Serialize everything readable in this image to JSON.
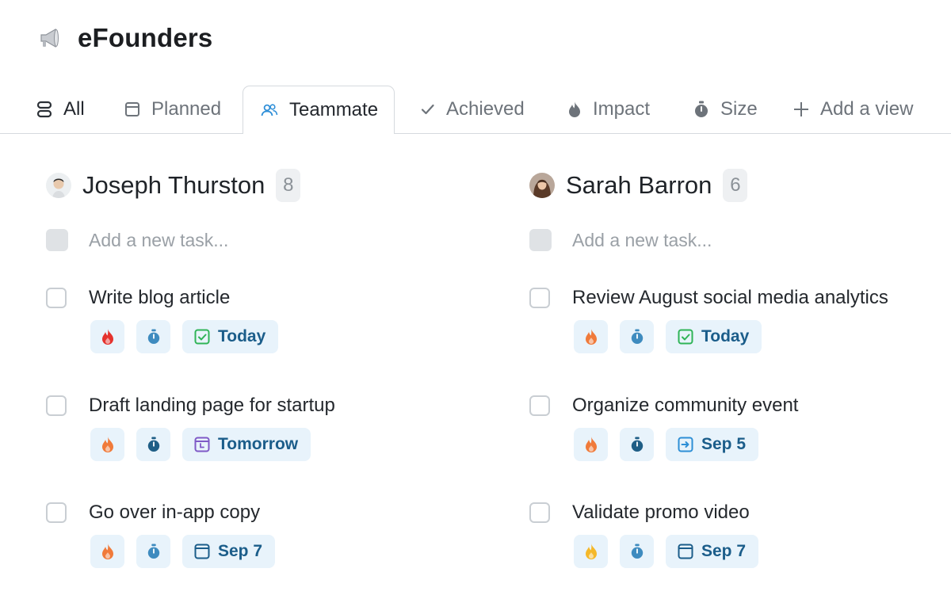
{
  "header": {
    "title": "eFounders",
    "logo_icon": "megaphone-icon"
  },
  "tabs": [
    {
      "label": "All",
      "icon": "stack-icon"
    },
    {
      "label": "Planned",
      "icon": "calendar-icon"
    },
    {
      "label": "Teammate",
      "icon": "people-icon",
      "active": true
    },
    {
      "label": "Achieved",
      "icon": "check-icon"
    },
    {
      "label": "Impact",
      "icon": "flame-icon"
    },
    {
      "label": "Size",
      "icon": "stopwatch-icon"
    },
    {
      "label": "Add a view",
      "icon": "plus-icon"
    }
  ],
  "columns": [
    {
      "name": "Joseph Thurston",
      "count": "8",
      "add_placeholder": "Add a new task...",
      "tasks": [
        {
          "title": "Write blog article",
          "date": "Today",
          "impact_color": "#e5322d",
          "date_icon": "calendar-check-icon"
        },
        {
          "title": "Draft landing page for startup",
          "date": "Tomorrow",
          "impact_color": "#f07a3a",
          "date_icon": "calendar-clock-icon"
        },
        {
          "title": "Go over in-app copy",
          "date": "Sep 7",
          "impact_color": "#f07a3a",
          "date_icon": "calendar-icon"
        }
      ]
    },
    {
      "name": "Sarah Barron",
      "count": "6",
      "add_placeholder": "Add a new task...",
      "tasks": [
        {
          "title": "Review August social media analytics",
          "date": "Today",
          "impact_color": "#f07a3a",
          "date_icon": "calendar-check-icon"
        },
        {
          "title": "Organize community event",
          "date": "Sep 5",
          "impact_color": "#f07a3a",
          "date_icon": "calendar-arrow-icon"
        },
        {
          "title": "Validate promo video",
          "date": "Sep 7",
          "impact_color": "#f5b829",
          "date_icon": "calendar-icon"
        }
      ]
    }
  ],
  "colors": {
    "chip_bg": "#e8f3fb",
    "date_text": "#1b5d8a",
    "active_tab_icon": "#2f8fd8",
    "today_green": "#2fb457",
    "tomorrow_purple": "#7f5ac7"
  }
}
